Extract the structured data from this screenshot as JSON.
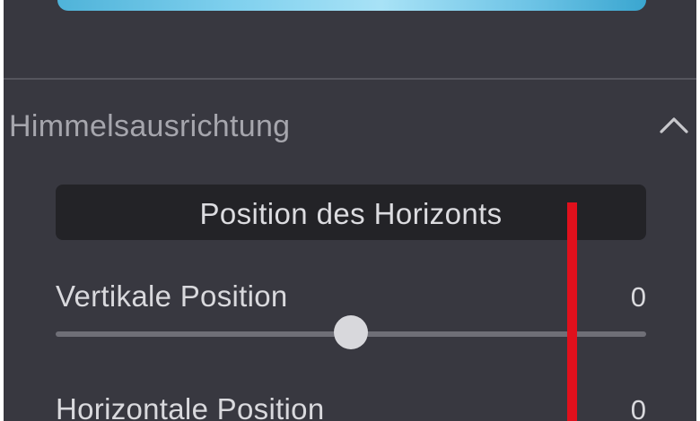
{
  "sky_section": {
    "title": "Himmelsausrichtung",
    "collapse_icon": "chevron-up-icon",
    "horizon_button_label": "Position des Horizonts"
  },
  "sliders": [
    {
      "label": "Vertikale Position",
      "value": "0",
      "level": 0.5
    },
    {
      "label": "Horizontale Position",
      "value": "0"
    }
  ],
  "colors": {
    "panel_background": "#383840",
    "button_background": "#232327",
    "text": "#d9d9dd",
    "section_title": "#a6a6ad",
    "annotation_marker": "#e0101c"
  }
}
